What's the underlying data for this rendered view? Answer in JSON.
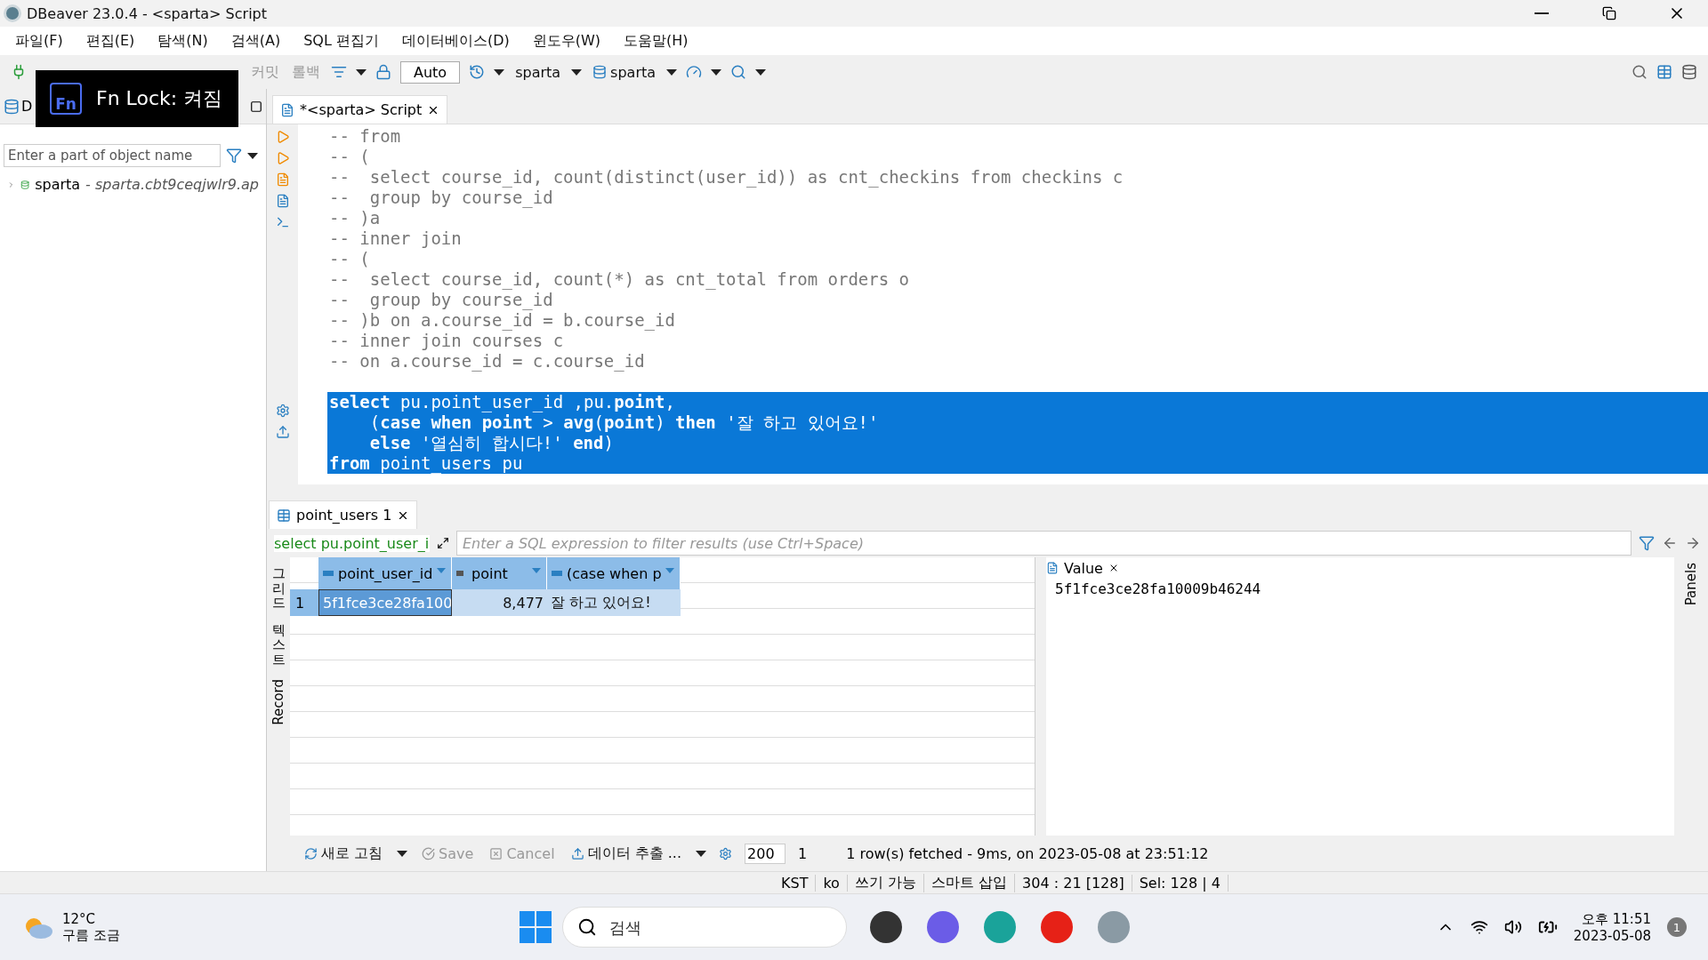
{
  "window": {
    "title": "DBeaver 23.0.4 - <sparta> Script"
  },
  "menu": [
    "파일(F)",
    "편집(E)",
    "탐색(N)",
    "검색(A)",
    "SQL 편집기",
    "데이터베이스(D)",
    "윈도우(W)",
    "도움말(H)"
  ],
  "toolbar": {
    "commit": "커밋",
    "rollback": "롤백",
    "mode": "Auto",
    "datasource": "sparta",
    "schema": "sparta"
  },
  "overlay": {
    "badge": "Fn",
    "text": "Fn Lock: 켜짐"
  },
  "navigator": {
    "tab": "D",
    "filter_placeholder": "Enter a part of object name",
    "tree": [
      {
        "label": "sparta",
        "detail": "- sparta.cbt9ceqjwlr9.ap",
        "expanded": false
      }
    ]
  },
  "editor": {
    "tab": "*<sparta> Script",
    "lines": [
      {
        "text": "-- from",
        "selected": false
      },
      {
        "text": "-- (",
        "selected": false
      },
      {
        "text": "--  select course_id, count(distinct(user_id)) as cnt_checkins from checkins c",
        "selected": false
      },
      {
        "text": "--  group by course_id",
        "selected": false
      },
      {
        "text": "-- )a",
        "selected": false
      },
      {
        "text": "-- inner join",
        "selected": false
      },
      {
        "text": "-- (",
        "selected": false
      },
      {
        "text": "--  select course_id, count(*) as cnt_total from orders o",
        "selected": false
      },
      {
        "text": "--  group by course_id",
        "selected": false
      },
      {
        "text": "-- )b on a.course_id = b.course_id",
        "selected": false
      },
      {
        "text": "-- inner join courses c",
        "selected": false
      },
      {
        "text": "-- on a.course_id = c.course_id",
        "selected": false
      },
      {
        "text": "**select** pu.point_user_id ,pu.**point**,",
        "selected": true
      },
      {
        "text": "    (**case** **when** **point** > **avg**(**point**) **then** '잘 하고 있어요!'",
        "selected": true
      },
      {
        "text": "    **else** '열심히 합시다!' **end**)",
        "selected": true
      },
      {
        "text": "**from** point_users pu ",
        "selected": true
      }
    ]
  },
  "results": {
    "tab": "point_users 1",
    "query": "select pu.point_user_i",
    "filter_placeholder": "Enter a SQL expression to filter results (use Ctrl+Space)",
    "side_tabs": [
      "그리드",
      "텍스트",
      "Record"
    ],
    "columns": [
      {
        "label": "point_user_id",
        "kind": "text"
      },
      {
        "label": "point",
        "kind": "number"
      },
      {
        "label": "(case when p",
        "kind": "text"
      }
    ],
    "rows": [
      {
        "number": "1",
        "selected": true,
        "cells": [
          {
            "text": "5f1fce3ce28fa100",
            "focused": true
          },
          {
            "text": "8,477",
            "focused": false
          },
          {
            "text": "잘 하고 있어요!",
            "focused": false
          }
        ]
      }
    ],
    "value_panel": {
      "title": "Value",
      "value": "5f1fce3ce28fa10009b46244"
    },
    "side_panel": "Panels"
  },
  "bottom_toolbar": {
    "refresh": "새로 고침",
    "save": "Save",
    "cancel": "Cancel",
    "export": "데이터 추출 ...",
    "fetch_size": "200",
    "row_count": "1",
    "message": "1 row(s) fetched - 9ms, on 2023-05-08 at 23:51:12"
  },
  "status_bar": [
    "KST",
    "ko",
    "쓰기 가능",
    "스마트 삽입",
    "304 : 21 [128]",
    "Sel: 128 | 4"
  ],
  "taskbar": {
    "weather": {
      "temp": "12°C",
      "desc": "구름 조금"
    },
    "search_placeholder": "검색",
    "time": "오후 11:51",
    "date": "2023-05-08",
    "notifications": "1"
  }
}
